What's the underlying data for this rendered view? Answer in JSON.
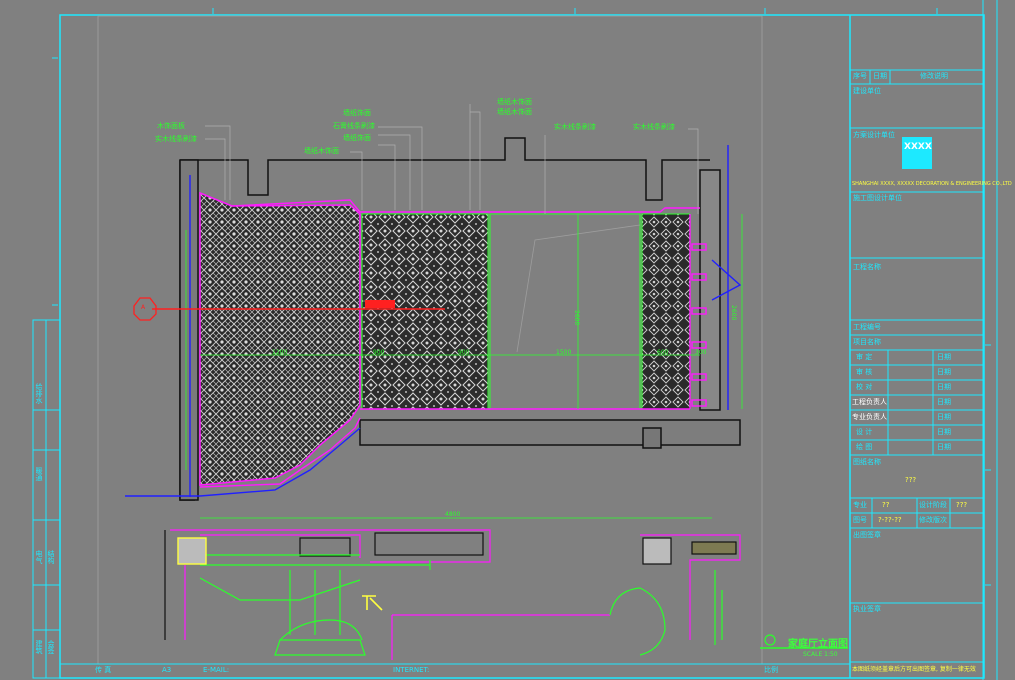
{
  "title_block": {
    "revision_header": {
      "no": "序号",
      "date": "日期",
      "desc": "修改说明"
    },
    "client": "建设单位",
    "design_unit": "方案设计单位",
    "company_name_en": "SHANGHAI XXXX, XXXXX DECORATION & ENGINEERING CO.,LTD",
    "company_logo_mark": "XXXX",
    "construction_unit": "施工图设计单位",
    "project_name": "工程名称",
    "project_no": "工程编号",
    "item_name": "项目名称",
    "roles": [
      {
        "role": "审 定",
        "date": "日期"
      },
      {
        "role": "审 核",
        "date": "日期"
      },
      {
        "role": "校 对",
        "date": "日期"
      },
      {
        "role": "工程负责人",
        "date": "日期"
      },
      {
        "role": "专业负责人",
        "date": "日期"
      },
      {
        "role": "设 计",
        "date": "日期"
      },
      {
        "role": "绘 图",
        "date": "日期"
      }
    ],
    "drawing_name": "图纸名称",
    "drawing_name_value": "???",
    "discipline": "专业",
    "discipline_value": "??",
    "design_stage": "设计阶段",
    "design_stage_value": "???",
    "drawing_no": "图号",
    "drawing_no_value": "?-??-??",
    "revision_no": "修改版次",
    "issue_stamp": "出图签章",
    "practice_stamp": "执业签章",
    "footer_note": "本图纸须经盖章后方可出图签章, 复制一律无效"
  },
  "left_strip": {
    "labels": [
      "给排水",
      "暖通",
      "电气",
      "结构",
      "建筑",
      "会签"
    ]
  },
  "bottom_strip": {
    "fax": "传 真",
    "size": "A3",
    "email": "E-MAIL:",
    "internet": "INTERNET:",
    "scale": "比例"
  },
  "drawing_title": {
    "main": "家庭厅立面图",
    "sub": "SCALE 1:50"
  },
  "callouts": {
    "left_stack": [
      "木饰面板",
      "实木线条刷漆"
    ],
    "middle_stack": [
      "墙纸饰面",
      "石膏线条刷漆",
      "墙纸饰面",
      "墙纸木饰面"
    ],
    "top_stack": [
      "墙纸木饰面",
      "墙纸木饰面"
    ],
    "right_1": "实木线条刷漆",
    "right_2": "实木线条刷漆"
  },
  "dimensions": {
    "total_width": "4800",
    "height_main": "2600",
    "height_right": "2600",
    "seg_1": "1200",
    "seg_2": "900",
    "seg_3": "900",
    "seg_4": "1500",
    "seg_5": "600",
    "seg_6": "300",
    "section_marker": "A"
  },
  "colors": {
    "frame": "#1de9ff",
    "callout": "#2bff2b",
    "magenta": "#ff1aff",
    "red": "#ff2020",
    "blue": "#2020ff",
    "yellow": "#ffff40",
    "background": "#808080"
  }
}
